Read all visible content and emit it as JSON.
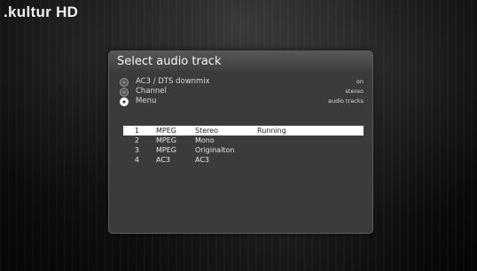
{
  "channel": {
    "logo_text": ".kultur HD"
  },
  "dialog": {
    "title": "Select audio track",
    "options": [
      {
        "label": "AC3 / DTS downmix",
        "value": "on",
        "selected": false
      },
      {
        "label": "Channel",
        "value": "stereo",
        "selected": false
      },
      {
        "label": "Menu",
        "value": "audio tracks",
        "selected": true
      }
    ],
    "tracks": [
      {
        "num": "1",
        "codec": "MPEG",
        "mode": "Stereo",
        "status": "Running",
        "selected": true
      },
      {
        "num": "2",
        "codec": "MPEG",
        "mode": "Mono",
        "status": "",
        "selected": false
      },
      {
        "num": "3",
        "codec": "MPEG",
        "mode": "Originalton",
        "status": "",
        "selected": false
      },
      {
        "num": "4",
        "codec": "AC3",
        "mode": "AC3",
        "status": "",
        "selected": false
      }
    ]
  },
  "colors": {
    "selection": "#ffffff",
    "dialog_bg": "#3b3b3b"
  }
}
